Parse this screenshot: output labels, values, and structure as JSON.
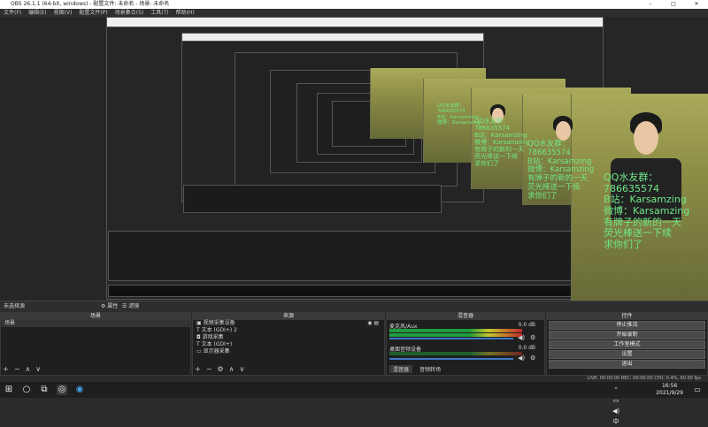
{
  "window": {
    "title": "OBS 26.1.1 (64-bit, windows) - 配置文件: 未命名 - 场景: 未命名",
    "controls": [
      "–",
      "□",
      "✕"
    ]
  },
  "menu": [
    "文件(F)",
    "编辑(E)",
    "视图(V)",
    "配置文件(P)",
    "场景集合(S)",
    "工具(T)",
    "帮助(H)"
  ],
  "overlay": {
    "lines": [
      "QQ水友群：",
      "786635574",
      "B站：Karsamzing",
      "微博：Karsamzing",
      "有牌子的新的一天",
      "荧光棒送一下续",
      "求你们了"
    ]
  },
  "scenebar": {
    "left": "未选择源",
    "props": "⚙ 属性",
    "filters": "☰ 滤镜"
  },
  "panels": {
    "scenes": {
      "title": "场景",
      "items": [
        "场景"
      ]
    },
    "sources": {
      "title": "来源",
      "items": [
        "视频采集设备",
        "文本 (GDI+) 2",
        "游戏采集",
        "文本 (GDI+)",
        "显示器采集"
      ]
    },
    "mixer": {
      "title": "混音器",
      "channels": [
        {
          "name": "麦克风/Aux",
          "db": "0.0 dB"
        },
        {
          "name": "桌面音频设备",
          "db": "0.0 dB"
        }
      ],
      "tabs": [
        "混音器",
        "音频转场"
      ]
    },
    "controls": {
      "title": "控件",
      "buttons": [
        "停止推流",
        "开始录制",
        "工作室模式",
        "设置",
        "退出"
      ]
    }
  },
  "status": {
    "text": "LIVE: 00:00:00    REC: 00:00:00    CPU: 0.4%, 60.00 fps"
  },
  "taskbar": {
    "time": "16:56",
    "date": "2021/9/29"
  }
}
